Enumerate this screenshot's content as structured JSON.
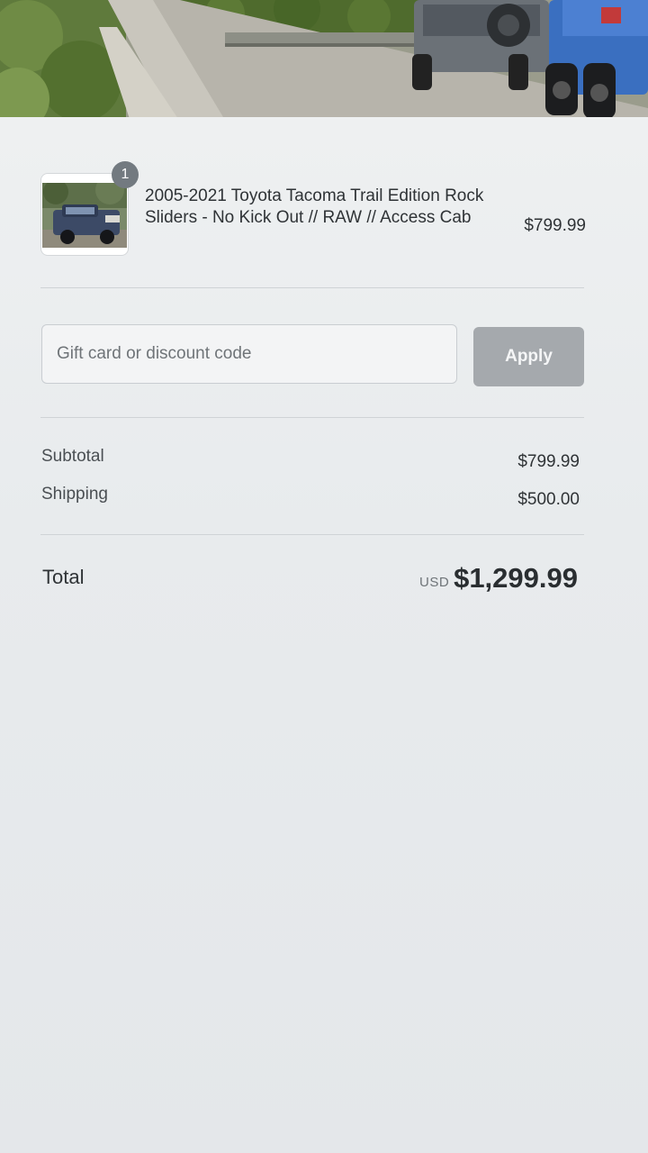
{
  "hero": {
    "image_icon": "truck-banner-image"
  },
  "product": {
    "quantity": "1",
    "name": "2005-2021 Toyota Tacoma Trail Edition Rock Sliders - No Kick Out // RAW // Access Cab",
    "price": "$799.99",
    "thumbnail_icon": "truck-thumbnail-image"
  },
  "discount": {
    "placeholder": "Gift card or discount code",
    "value": "",
    "apply_label": "Apply"
  },
  "totals": {
    "subtotal_label": "Subtotal",
    "subtotal_value": "$799.99",
    "shipping_label": "Shipping",
    "shipping_value": "$500.00",
    "total_label": "Total",
    "currency": "USD",
    "total_value": "$1,299.99"
  },
  "colors": {
    "apply_button_disabled": "#a5a9ad",
    "badge": "#737a80",
    "divider": "#cfd3d6"
  }
}
